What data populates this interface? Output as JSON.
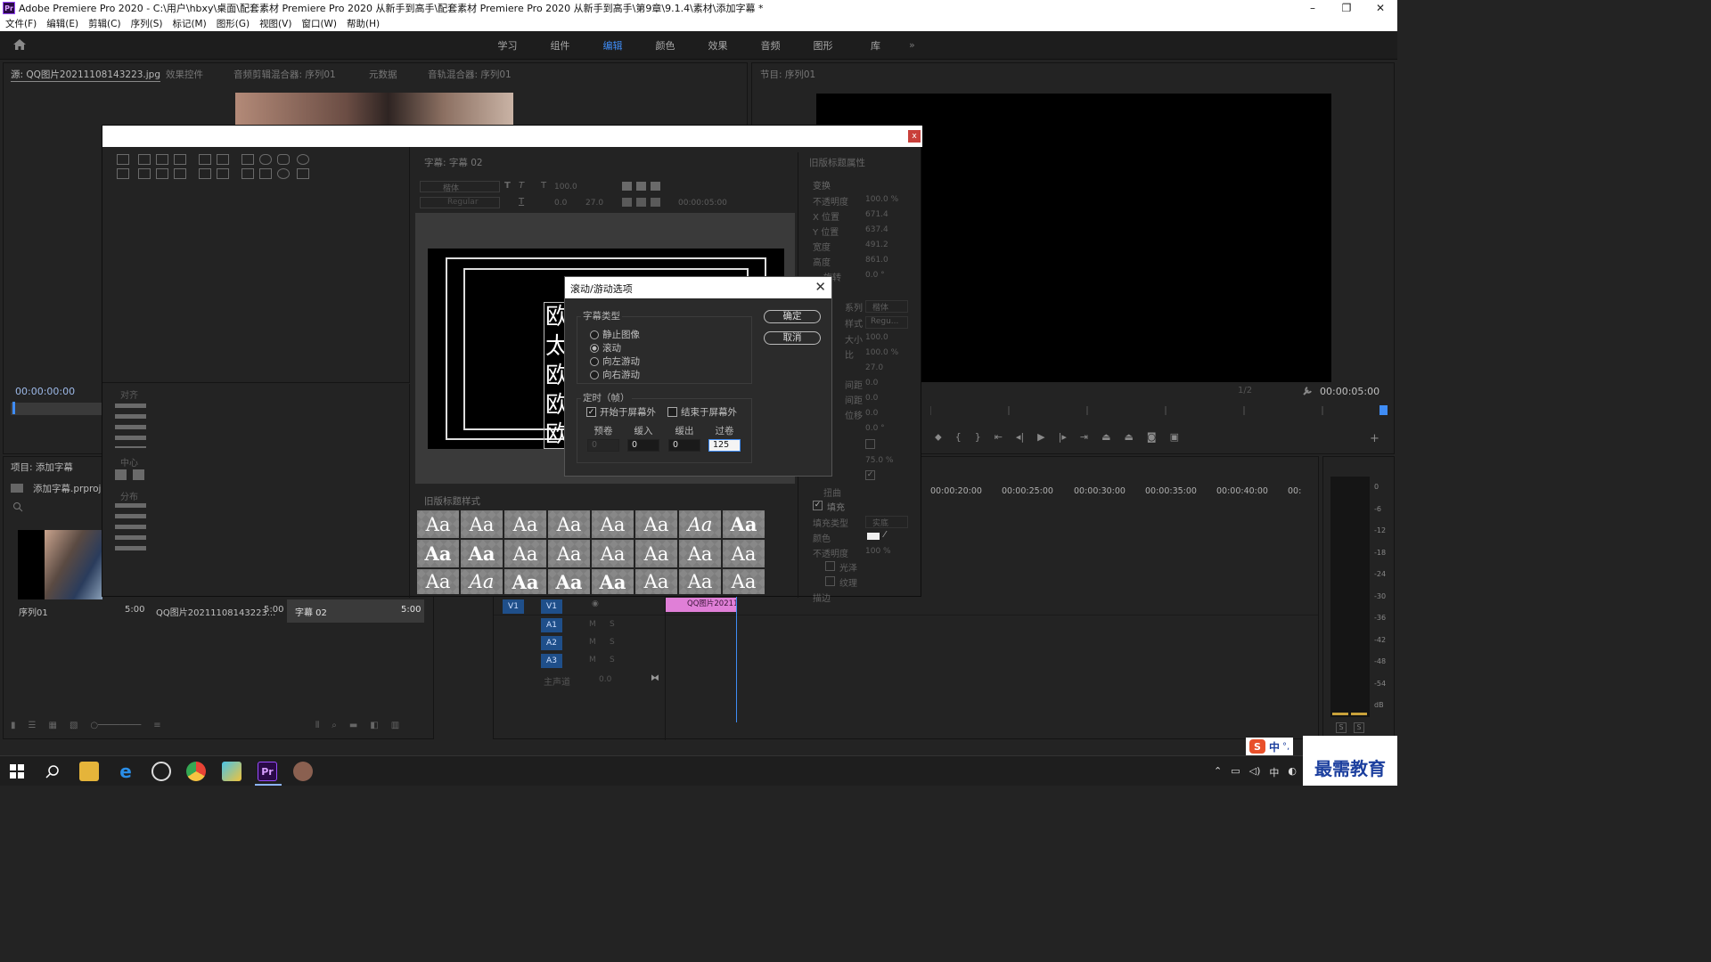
{
  "window": {
    "title": "Adobe Premiere Pro 2020 - C:\\用户\\hbxy\\桌面\\配套素材 Premiere Pro 2020 从新手到高手\\配套素材 Premiere Pro 2020 从新手到高手\\第9章\\9.1.4\\素材\\添加字幕 *",
    "logo": "Pr",
    "minimize": "–",
    "maximize": "❐",
    "close": "✕"
  },
  "menu": [
    "文件(F)",
    "编辑(E)",
    "剪辑(C)",
    "序列(S)",
    "标记(M)",
    "图形(G)",
    "视图(V)",
    "窗口(W)",
    "帮助(H)"
  ],
  "workspaces": {
    "tabs": [
      "学习",
      "组件",
      "编辑",
      "颜色",
      "效果",
      "音频",
      "图形",
      "库"
    ],
    "active": "编辑",
    "more": "»"
  },
  "source_panel": {
    "tabs": [
      "源: QQ图片20211108143223.jpg",
      "效果控件",
      "音频剪辑混合器: 序列01",
      "元数据",
      "音轨混合器: 序列01"
    ],
    "timecode": "00:00:00:00"
  },
  "program_panel": {
    "title": "节目: 序列01",
    "timecode": "00:00:05:00",
    "zoom": "1/2"
  },
  "project_panel": {
    "title": "项目: 添加字幕",
    "file": "添加字幕.prproj",
    "items": [
      {
        "name": "序列01",
        "duration": "5:00"
      },
      {
        "name": "QQ图片20211108143223...",
        "duration": "5:00"
      },
      {
        "name": "字幕 02",
        "duration": "5:00"
      }
    ]
  },
  "titler": {
    "close": "x",
    "title_tab": "字幕: 字幕 02",
    "font_family": "楷体",
    "font_style": "Regular",
    "font_size": "100.0",
    "leading": "0.0",
    "kerning": "27.0",
    "tab_time": "00:00:05:00",
    "align_label": "对齐",
    "center_label": "中心",
    "distribute_label": "分布",
    "styles_title": "旧版标题样式",
    "style_sample": "Aa",
    "canvas_chars": [
      "欧",
      "太",
      "欧",
      "欧",
      "欧"
    ],
    "properties": {
      "title": "旧版标题属性",
      "transform": "变换",
      "rows": [
        {
          "label": "不透明度",
          "value": "100.0 %"
        },
        {
          "label": "X 位置",
          "value": "671.4"
        },
        {
          "label": "Y 位置",
          "value": "637.4"
        },
        {
          "label": "宽度",
          "value": "491.2"
        },
        {
          "label": "高度",
          "value": "861.0"
        },
        {
          "label": "旋转",
          "value": "0.0 °"
        }
      ],
      "font_family_label": "系列",
      "font_family_val": "楷体",
      "font_style_label": "样式",
      "font_style_val": "Regu...",
      "more_rows": [
        {
          "label": "大小",
          "value": "100.0"
        },
        {
          "label": "比",
          "value": "100.0 %"
        },
        {
          "label": "",
          "value": "27.0"
        },
        {
          "label": "间距",
          "value": "0.0"
        },
        {
          "label": "间距",
          "value": "0.0"
        },
        {
          "label": "位移",
          "value": "0.0"
        },
        {
          "label": "",
          "value": "0.0 °"
        }
      ],
      "val_75": "75.0 %",
      "distort": "扭曲",
      "fill": "填充",
      "fill_type_label": "填充类型",
      "fill_type_val": "实底",
      "color_label": "颜色",
      "opacity_label": "不透明度",
      "opacity_val": "100 %",
      "sheen": "光泽",
      "texture": "纹理",
      "stroke": "描边"
    }
  },
  "roll_dialog": {
    "title": "滚动/游动选项",
    "close": "✕",
    "type_group": "字幕类型",
    "types": [
      "静止图像",
      "滚动",
      "向左游动",
      "向右游动"
    ],
    "selected_type": "滚动",
    "timing_group": "定时（帧）",
    "start_offscreen": "开始于屏幕外",
    "end_offscreen": "结束于屏幕外",
    "start_offscreen_checked": true,
    "end_offscreen_checked": false,
    "fields": [
      {
        "label": "预卷",
        "value": "0"
      },
      {
        "label": "缓入",
        "value": "0"
      },
      {
        "label": "缓出",
        "value": "0"
      },
      {
        "label": "过卷",
        "value": "125"
      }
    ],
    "ok": "确定",
    "cancel": "取消"
  },
  "timeline": {
    "ruler": [
      "00:00:20:00",
      "00:00:25:00",
      "00:00:30:00",
      "00:00:35:00",
      "00:00:40:00",
      "00:"
    ],
    "tracks": [
      "V1",
      "A1",
      "A2",
      "A3"
    ],
    "master": "主声道",
    "master_val": "0.0",
    "clip": "QQ图片202111",
    "mute": "M",
    "solo": "S"
  },
  "meter": {
    "scale": [
      "0",
      "-6",
      "-12",
      "-18",
      "-24",
      "-30",
      "-36",
      "-42",
      "-48",
      "-54",
      "dB"
    ],
    "solo": "S"
  },
  "ime": {
    "lang": "中",
    "extra": "°,"
  },
  "watermark": "最需教育",
  "colors": {
    "accent": "#3f8cf5",
    "clip": "#e07fd7",
    "close_red": "#c9403b"
  }
}
